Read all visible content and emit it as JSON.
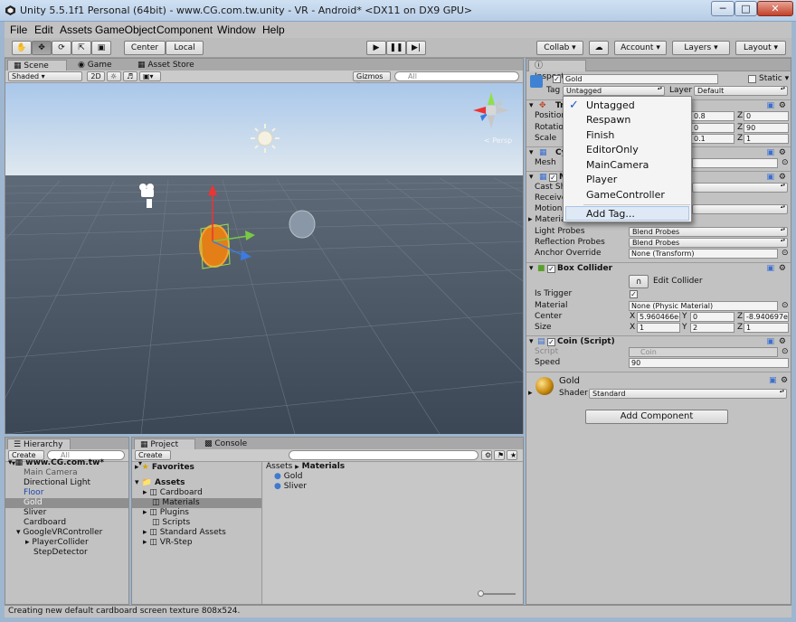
{
  "window": {
    "title": "Unity 5.5.1f1 Personal (64bit) - www.CG.com.tw.unity - VR - Android* <DX11 on DX9 GPU>",
    "min": "─",
    "max": "□",
    "close": "✕"
  },
  "menubar": [
    "File",
    "Edit",
    "Assets",
    "GameObject",
    "Component",
    "Window",
    "Help"
  ],
  "toolbar": {
    "center": "Center",
    "local": "Local",
    "collab": "Collab ▾",
    "account": "Account",
    "layers": "Layers",
    "layout": "Layout"
  },
  "scene": {
    "tabs": [
      "Scene",
      "Game",
      "Asset Store"
    ],
    "shading": "Shaded",
    "mode2d": "2D",
    "gizmos": "Gizmos ▾",
    "search_placeholder": "All",
    "persp": "< Persp"
  },
  "hierarchy": {
    "tab": "Hierarchy",
    "create": "Create ▾",
    "search_placeholder": "All",
    "root": "www.CG.com.tw*",
    "items": [
      "Main Camera",
      "Directional Light",
      "Floor",
      "Gold",
      "Sliver",
      "Cardboard",
      "GoogleVRController",
      "PlayerCollider",
      "StepDetector"
    ]
  },
  "project": {
    "tabs": [
      "Project",
      "Console"
    ],
    "create": "Create ▾",
    "favorites": "Favorites",
    "assets": "Assets",
    "folders": [
      "Cardboard",
      "Materials",
      "Plugins",
      "Scripts",
      "Standard Assets",
      "VR-Step"
    ],
    "breadcrumb": [
      "Assets",
      "▶",
      "Materials"
    ],
    "files": [
      "Gold",
      "Sliver"
    ]
  },
  "inspector": {
    "tab": "Inspector",
    "name": "Gold",
    "static": "Static ▾",
    "tag_label": "Tag",
    "tag_value": "Untagged",
    "layer_label": "Layer",
    "layer_value": "Default",
    "transform": {
      "title": "Tr",
      "position_label": "Position",
      "rotation_label": "Rotation",
      "scale_label": "Scale",
      "pos": [
        "0.8",
        "0"
      ],
      "rot": [
        "0",
        "90"
      ],
      "scl": [
        "0.1",
        "1"
      ],
      "y": "Y",
      "z": "Z"
    },
    "mesh_filter": {
      "title": "Cy",
      "mesh_label": "Mesh"
    },
    "mesh_renderer": {
      "title": "Me",
      "rows": [
        "Cast Sh",
        "Receive",
        "Motion V",
        "Material"
      ],
      "light_probes": "Light Probes",
      "light_probes_val": "Blend Probes",
      "reflection_probes": "Reflection Probes",
      "reflection_probes_val": "Blend Probes",
      "anchor": "Anchor Override",
      "anchor_val": "None (Transform)"
    },
    "box_collider": {
      "title": "Box Collider",
      "edit": "Edit Collider",
      "is_trigger": "Is Trigger",
      "material": "Material",
      "material_val": "None (Physic Material)",
      "center": "Center",
      "center_x": "5.960466e-",
      "center_y": "0",
      "center_z": "-8.940697e",
      "size": "Size",
      "size_x": "1",
      "size_y": "2",
      "size_z": "1",
      "x": "X",
      "y": "Y",
      "z": "Z"
    },
    "coin": {
      "title": "Coin (Script)",
      "script_label": "Script",
      "script_val": "Coin",
      "speed_label": "Speed",
      "speed_val": "90"
    },
    "material": {
      "name": "Gold",
      "shader_label": "Shader",
      "shader_val": "Standard"
    },
    "add_component": "Add Component"
  },
  "tag_menu": {
    "items": [
      "Untagged",
      "Respawn",
      "Finish",
      "EditorOnly",
      "MainCamera",
      "Player",
      "GameController"
    ],
    "add": "Add Tag...",
    "check": "✓"
  },
  "status": "Creating new default cardboard screen texture 808x524.",
  "colors": {
    "sky_top": "#a9c7ea",
    "sky_horizon": "#e9eef2",
    "ground": "#444f5e",
    "gold": "#e37f16",
    "selection": "#8f8f8f",
    "accent": "#3b6fd0"
  }
}
